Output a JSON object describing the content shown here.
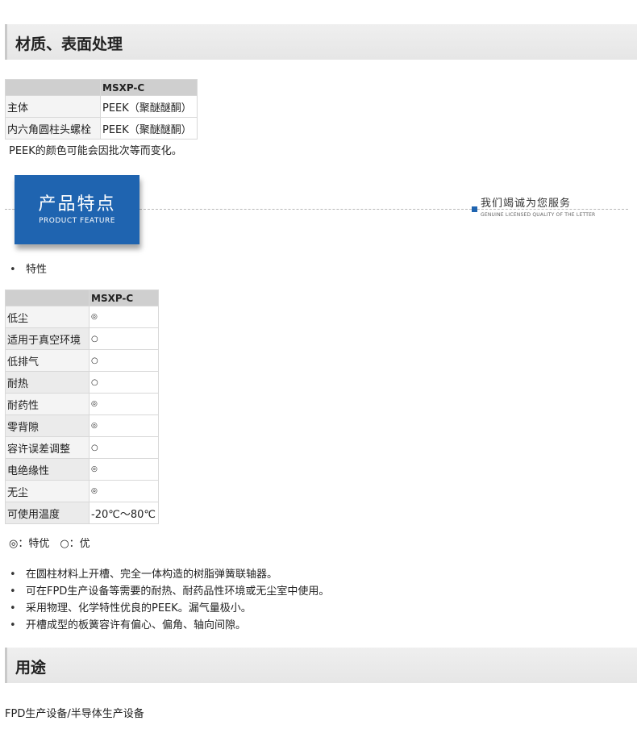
{
  "section_material": {
    "title": "材质、表面处理",
    "table": {
      "header": [
        "",
        "MSXP-C"
      ],
      "rows": [
        [
          "主体",
          "PEEK（聚醚醚酮）"
        ],
        [
          "内六角圆柱头螺栓",
          "PEEK（聚醚醚酮）"
        ]
      ]
    },
    "note": "PEEK的颜色可能会因批次等而变化。"
  },
  "banner": {
    "title_cn": "产品特点",
    "title_en": "PRODUCT FEATURE",
    "slogan": "我们竭诚为您服务",
    "slogan_en": "GENUINE LICENSED QUALITY OF THE LETTER"
  },
  "features": {
    "heading_bullet": "特性",
    "table": {
      "header": [
        "",
        "MSXP-C"
      ],
      "rows": [
        [
          "低尘",
          "◎"
        ],
        [
          "适用于真空环境",
          "○"
        ],
        [
          "低排气",
          "○"
        ],
        [
          "耐热",
          "○"
        ],
        [
          "耐药性",
          "◎"
        ],
        [
          "零背隙",
          "◎"
        ],
        [
          "容许误差调整",
          "○"
        ],
        [
          "电绝缘性",
          "◎"
        ],
        [
          "无尘",
          "◎"
        ],
        [
          "可使用温度",
          "-20℃～80℃"
        ]
      ]
    },
    "legend": "◎：特优　○：优",
    "bullets": [
      "在圆柱材料上开槽、完全一体构造的树脂弹簧联轴器。",
      "可在FPD生产设备等需要的耐热、耐药品性环境或无尘室中使用。",
      "采用物理、化学特性优良的PEEK。漏气量极小。",
      "开槽成型的板簧容许有偏心、偏角、轴向间隙。"
    ]
  },
  "section_usage": {
    "title": "用途",
    "text": "FPD生产设备/半导体生产设备"
  }
}
